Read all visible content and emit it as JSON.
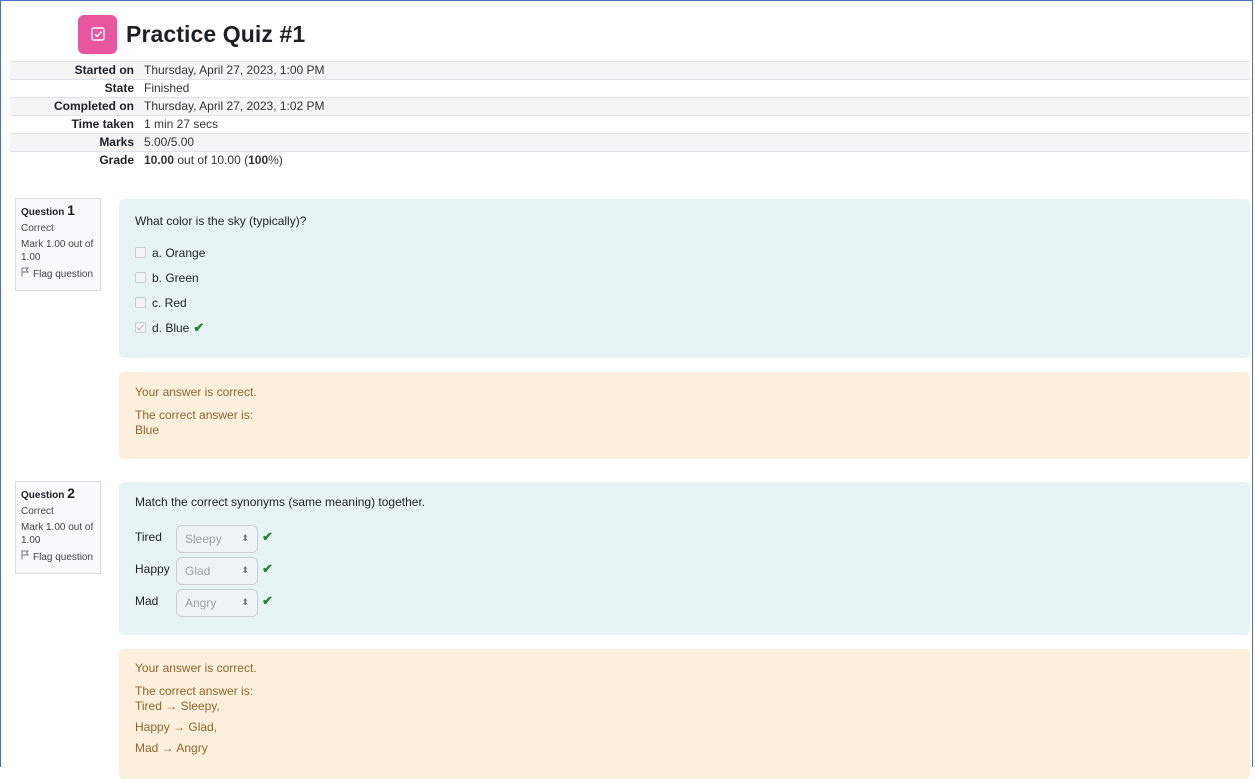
{
  "title": "Practice Quiz #1",
  "summary": [
    {
      "label": "Started on",
      "value": "Thursday, April 27, 2023, 1:00 PM"
    },
    {
      "label": "State",
      "value": "Finished"
    },
    {
      "label": "Completed on",
      "value": "Thursday, April 27, 2023, 1:02 PM"
    },
    {
      "label": "Time taken",
      "value": "1 min 27 secs"
    },
    {
      "label": "Marks",
      "value": "5.00/5.00"
    }
  ],
  "grade": {
    "label": "Grade",
    "score": "10.00",
    "middle": " out of 10.00 (",
    "percent": "100",
    "end": "%)"
  },
  "q1": {
    "word": "Question",
    "number": "1",
    "state": "Correct",
    "mark": "Mark 1.00 out of 1.00",
    "flag": "Flag question",
    "text": "What color is the sky (typically)?",
    "options": [
      {
        "label": "a. Orange",
        "checked": false
      },
      {
        "label": "b. Green",
        "checked": false
      },
      {
        "label": "c. Red",
        "checked": false
      },
      {
        "label": "d. Blue",
        "checked": true
      }
    ],
    "feedback": {
      "result": "Your answer is correct.",
      "intro": "The correct answer is:",
      "answer": "Blue"
    }
  },
  "q2": {
    "word": "Question",
    "number": "2",
    "state": "Correct",
    "mark": "Mark 1.00 out of 1.00",
    "flag": "Flag question",
    "text": "Match the correct synonyms (same meaning) together.",
    "pairs": [
      {
        "left": "Tired",
        "selected": "Sleepy"
      },
      {
        "left": "Happy",
        "selected": "Glad"
      },
      {
        "left": "Mad",
        "selected": "Angry"
      }
    ],
    "feedback": {
      "result": "Your answer is correct.",
      "intro": "The correct answer is:",
      "lines": [
        "Tired → Sleepy,",
        "Happy → Glad,",
        "Mad → Angry"
      ]
    }
  },
  "colors": {
    "accent_icon": "#e9559f",
    "correct": "#1f8a33",
    "question_bg": "#e7f3f5",
    "feedback_bg": "#fcefdc"
  }
}
